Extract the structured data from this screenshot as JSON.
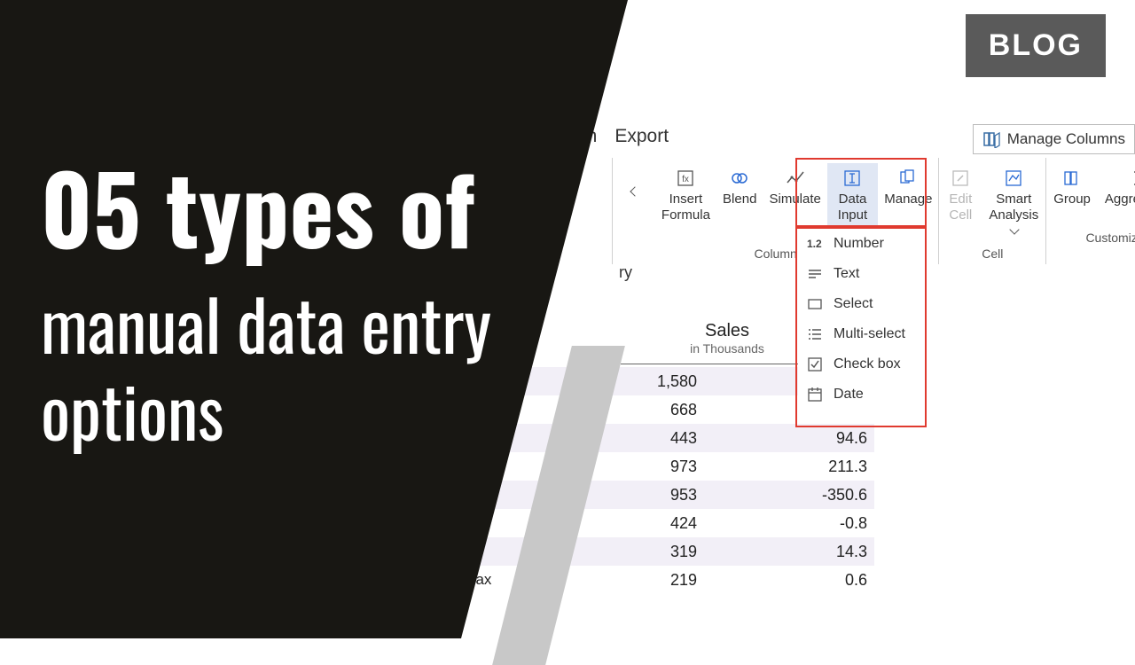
{
  "badge": "BLOG",
  "title": {
    "line1": "05 types of",
    "line2a": "manual data entry",
    "line2b": "options"
  },
  "tabs": {
    "partial1": "gn",
    "export": "Export"
  },
  "manage_columns": "Manage Columns",
  "ribbon": {
    "insert_formula": {
      "l1": "Insert",
      "l2": "Formula"
    },
    "blend": "Blend",
    "simulate": "Simulate",
    "data_input": {
      "l1": "Data",
      "l2": "Input"
    },
    "manage": "Manage",
    "edit_cell": {
      "l1": "Edit",
      "l2": "Cell"
    },
    "smart_analysis": {
      "l1": "Smart",
      "l2": "Analysis"
    },
    "group": "Group",
    "aggregation": "Aggregation",
    "groups": {
      "column": "Column",
      "cell": "Cell",
      "customize": "Customize"
    }
  },
  "dropdown": {
    "number": "Number",
    "text": "Text",
    "select": "Select",
    "multi_select": "Multi-select",
    "check_box": "Check box",
    "date": "Date"
  },
  "partial_ry": "ry",
  "table": {
    "col1": {
      "title": "Sales",
      "sub": "in Thousands"
    },
    "rows": [
      {
        "label": "",
        "v1": "1,580",
        "v2": ""
      },
      {
        "label": "",
        "v1": "668",
        "v2": ""
      },
      {
        "label": "",
        "v1": "443",
        "v2": "94.6"
      },
      {
        "label": "",
        "v1": "973",
        "v2": "211.3"
      },
      {
        "label": "",
        "v1": "953",
        "v2": "-350.6"
      },
      {
        "label": "",
        "v1": "424",
        "v2": "-0.8"
      },
      {
        "label": "",
        "v1": "319",
        "v2": "14.3"
      },
      {
        "label": "& Fax",
        "v1": "219",
        "v2": "0.6"
      }
    ]
  }
}
